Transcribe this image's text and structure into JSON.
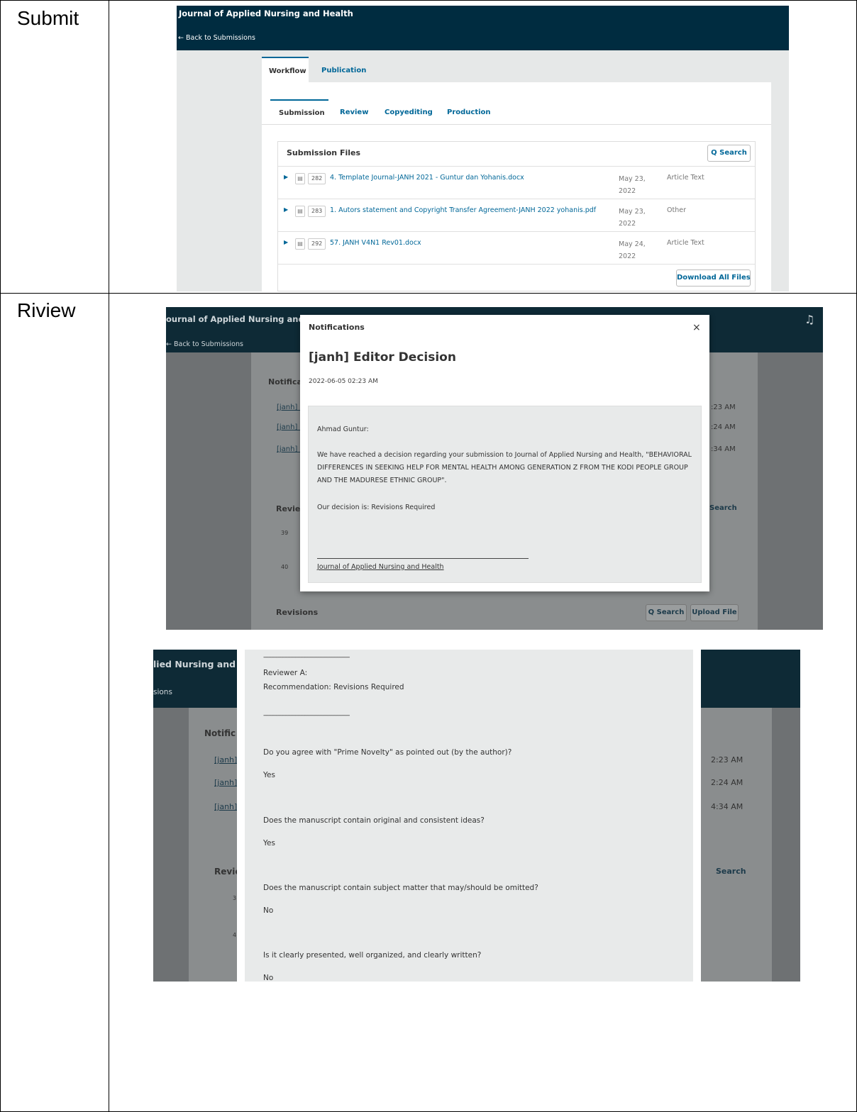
{
  "rows": [
    {
      "label": "Submit"
    },
    {
      "label": "Riview"
    }
  ],
  "submit_shot": {
    "journal_title": "Journal of Applied Nursing and Health",
    "back_link": "← Back to Submissions",
    "main_tabs": [
      "Workflow",
      "Publication"
    ],
    "stage_tabs": [
      "Submission",
      "Review",
      "Copyediting",
      "Production"
    ],
    "panel_title": "Submission Files",
    "search_label": "Q Search",
    "files": [
      {
        "id": "282",
        "name": "4. Template Journal-JANH 2021 - Guntur dan Yohanis.docx",
        "date": "May 23, 2022",
        "type": "Article Text"
      },
      {
        "id": "283",
        "name": "1. Autors statement and Copyright Transfer Agreement-JANH 2022 yohanis.pdf",
        "date": "May 23, 2022",
        "type": "Other"
      },
      {
        "id": "292",
        "name": "57. JANH V4N1 Rev01.docx",
        "date": "May 24, 2022",
        "type": "Article Text"
      }
    ],
    "download_all": "Download All Files"
  },
  "review_shot1": {
    "journal_title_partial": "ournal of Applied Nursing and H",
    "back_link": "← Back to Submissions",
    "bg_notifications": "Notifica",
    "bg_links": [
      "[janh] E",
      "[janh] E",
      "[janh] E"
    ],
    "bg_times": [
      ":23 AM",
      ":24 AM",
      ":34 AM"
    ],
    "bg_review": "Reviev",
    "bg_ids": [
      "39",
      "40"
    ],
    "bg_search": "Search",
    "revisions_label": "Revisions",
    "revisions_search": "Q Search",
    "upload_file": "Upload File",
    "modal": {
      "header": "Notifications",
      "close": "×",
      "title": "[janh] Editor Decision",
      "datetime": "2022-06-05 02:23 AM",
      "salutation": "Ahmad Guntur:",
      "paragraph": "We have reached a decision regarding your submission to Journal of Applied Nursing and Health, \"BEHAVIORAL DIFFERENCES IN SEEKING HELP FOR MENTAL HEALTH AMONG GENERATION Z FROM THE KODI PEOPLE GROUP AND THE MADURESE ETHNIC GROUP\".",
      "decision": "Our decision is: Revisions Required",
      "signature_link": "Journal of Applied Nursing and Health"
    }
  },
  "review_shot2": {
    "journal_partial": "lied Nursing and H",
    "back_partial": "sions",
    "bg_notif": "Notific",
    "bg_links": [
      "[janh]",
      "[janh]",
      "[janh]"
    ],
    "bg_times": [
      "2:23 AM",
      "2:24 AM",
      "4:34 AM"
    ],
    "bg_review": "Revie",
    "bg_ids": [
      "3",
      "4"
    ],
    "bg_search": "Search",
    "separator": "------------------------------------------------------",
    "reviewer": "Reviewer A:",
    "recommendation": "Recommendation: Revisions Required",
    "qa": [
      {
        "q": "Do you agree with \"Prime Novelty\" as pointed out (by the author)?",
        "a": "Yes"
      },
      {
        "q": "Does the manuscript contain original and consistent ideas?",
        "a": "Yes"
      },
      {
        "q": "Does the manuscript contain subject matter that may/should be omitted?",
        "a": "No"
      },
      {
        "q": "Is it clearly presented, well organized, and clearly written?",
        "a": "No"
      }
    ]
  }
}
